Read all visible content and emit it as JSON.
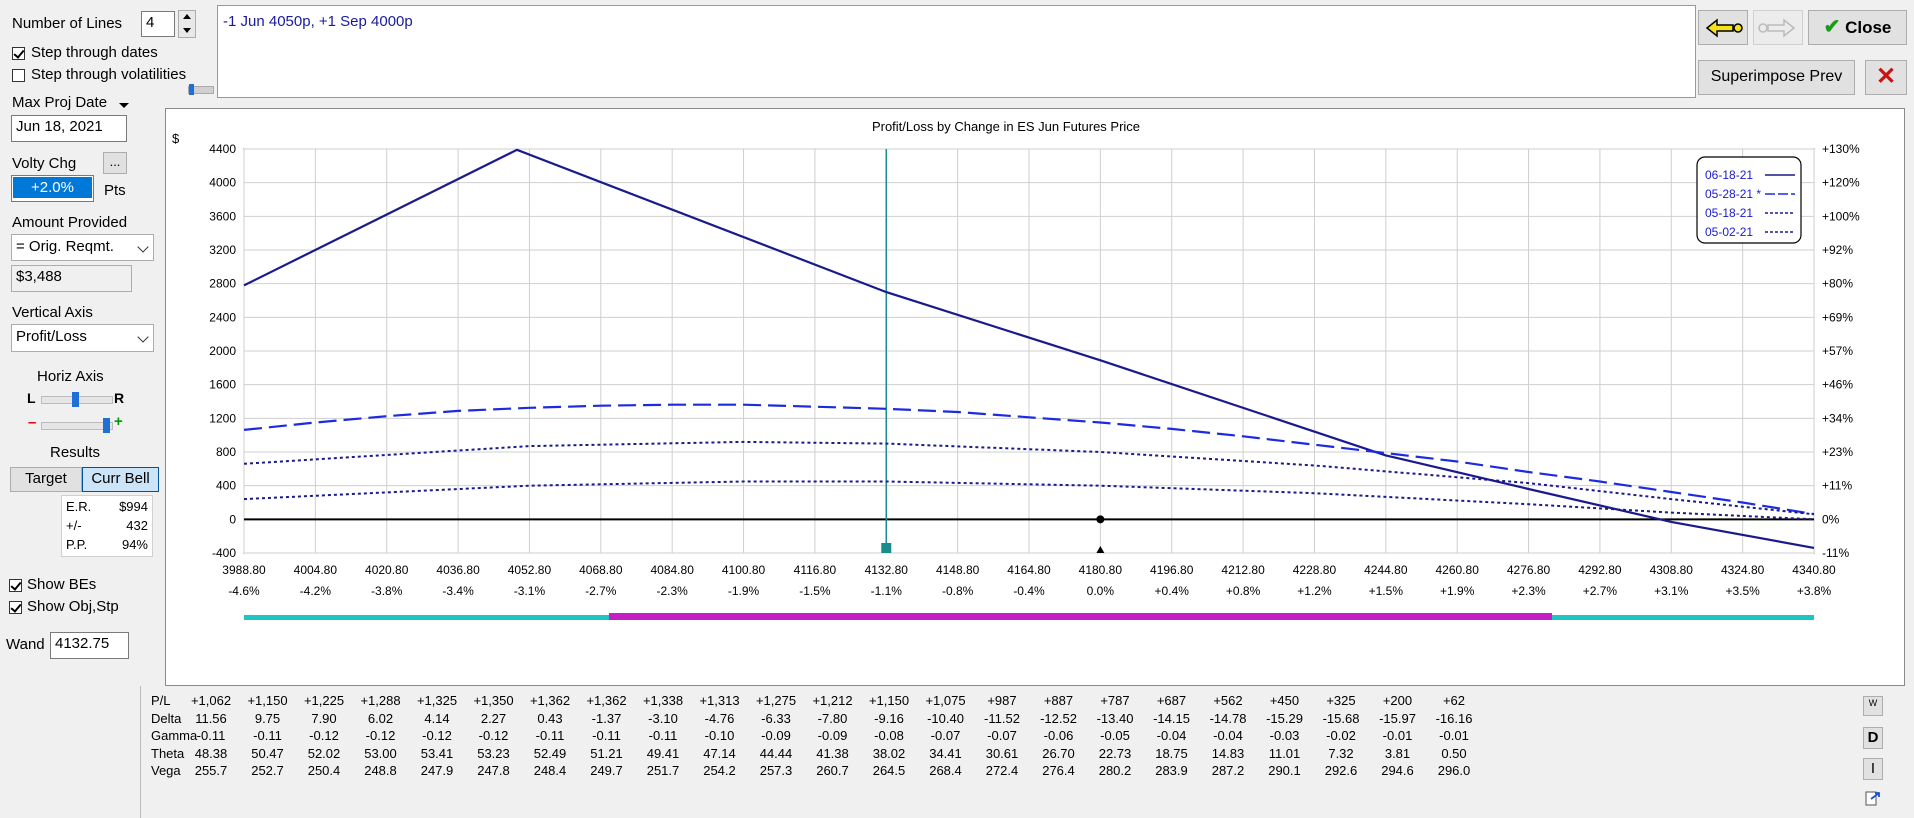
{
  "controls": {
    "number_of_lines_label": "Number of Lines",
    "number_of_lines_value": "4",
    "step_through_dates": "Step through dates",
    "step_through_volatilities": "Step through volatilities",
    "max_proj_date_label": "Max Proj Date",
    "max_proj_date_value": "Jun 18, 2021",
    "volty_chg_label": "Volty Chg",
    "volty_chg_value": "+2.0%",
    "volty_more": "...",
    "pts_label": "Pts",
    "amount_provided_label": "Amount Provided",
    "amount_provided_value": "= Orig. Reqmt.",
    "amount_value": "$3,488",
    "vertical_axis_label": "Vertical Axis",
    "vertical_axis_value": "Profit/Loss",
    "horiz_axis_label": "Horiz Axis",
    "slider_l": "L",
    "slider_r": "R",
    "slider_minus": "–",
    "slider_plus": "+",
    "results_label": "Results",
    "target_button": "Target",
    "curr_bell_button": "Curr Bell",
    "er_label": "E.R.",
    "er_value": "$994",
    "pm_label": "+/-",
    "pm_value": "432",
    "pp_label": "P.P.",
    "pp_value": "94%",
    "show_bes": "Show BEs",
    "show_obj_stp": "Show Obj,Stp",
    "wand_label": "Wand",
    "wand_value": "4132.75"
  },
  "position_text": "-1 Jun 4050p, +1 Sep 4000p",
  "toolbar": {
    "close_label": "Close",
    "superimpose_label": "Superimpose Prev"
  },
  "colors": {
    "line": "#1a1a8c",
    "dashed": "#1d2be0",
    "cursor": "#1a8c8c",
    "band_teal": "#1fc4c4",
    "band_magenta": "#c41fc4"
  },
  "chart_data": {
    "type": "line",
    "title": "Profit/Loss by Change in ES Jun Futures Price",
    "ylabel": "$",
    "ylim": [
      -400,
      4400
    ],
    "yticks": [
      4400,
      4000,
      3600,
      3200,
      2800,
      2400,
      2000,
      1600,
      1200,
      800,
      400,
      0,
      -400
    ],
    "right_ticks": [
      "+130%",
      "+120%",
      "+100%",
      "+92%",
      "+80%",
      "+69%",
      "+57%",
      "+46%",
      "+34%",
      "+23%",
      "+11%",
      "0%",
      "-11%"
    ],
    "x_ticks": [
      "3988.80",
      "4004.80",
      "4020.80",
      "4036.80",
      "4052.80",
      "4068.80",
      "4084.80",
      "4100.80",
      "4116.80",
      "4132.80",
      "4148.80",
      "4164.80",
      "4180.80",
      "4196.80",
      "4212.80",
      "4228.80",
      "4244.80",
      "4260.80",
      "4276.80",
      "4292.80",
      "4308.80",
      "4324.80",
      "4340.80"
    ],
    "x_pct": [
      "-4.6%",
      "-4.2%",
      "-3.8%",
      "-3.4%",
      "-3.1%",
      "-2.7%",
      "-2.3%",
      "-1.9%",
      "-1.5%",
      "-1.1%",
      "-0.8%",
      "-0.4%",
      "0.0%",
      "+0.4%",
      "+0.8%",
      "+1.2%",
      "+1.5%",
      "+1.9%",
      "+2.3%",
      "+2.7%",
      "+3.1%",
      "+3.5%",
      "+3.8%"
    ],
    "xlim": [
      3988.8,
      4340.8
    ],
    "cursor_x": 4132.8,
    "current_x": 4180.8,
    "series": [
      {
        "name": "06-18-21",
        "style": "solid",
        "x": [
          3988.8,
          4050,
          4132.8,
          4180.8,
          4244.8,
          4276.8,
          4308.8,
          4340.8
        ],
        "values": [
          2780,
          4390,
          2700,
          1890,
          760,
          360,
          -30,
          -340
        ]
      },
      {
        "name": "05-28-21",
        "legend_label": "05-28-21 *",
        "style": "longdash",
        "x": [
          3988.8,
          4004.8,
          4020.8,
          4036.8,
          4052.8,
          4068.8,
          4084.8,
          4100.8,
          4116.8,
          4132.8,
          4148.8,
          4164.8,
          4180.8,
          4196.8,
          4212.8,
          4228.8,
          4244.8,
          4260.8,
          4276.8,
          4292.8,
          4308.8,
          4324.8,
          4340.8
        ],
        "values": [
          1062,
          1150,
          1225,
          1288,
          1325,
          1350,
          1362,
          1362,
          1338,
          1313,
          1275,
          1212,
          1150,
          1075,
          987,
          887,
          787,
          687,
          562,
          450,
          325,
          200,
          62
        ]
      },
      {
        "name": "05-18-21",
        "style": "dotted",
        "x": [
          3988.8,
          4052.8,
          4100.8,
          4132.8,
          4180.8,
          4228.8,
          4276.8,
          4308.8,
          4340.8
        ],
        "values": [
          660,
          870,
          920,
          900,
          800,
          640,
          430,
          240,
          60
        ]
      },
      {
        "name": "05-02-21",
        "style": "dotted",
        "x": [
          3988.8,
          4052.8,
          4100.8,
          4132.8,
          4180.8,
          4228.8,
          4276.8,
          4308.8,
          4340.8
        ],
        "values": [
          240,
          400,
          450,
          450,
          400,
          310,
          180,
          80,
          0
        ]
      }
    ]
  },
  "table": {
    "row_labels": [
      "P/L",
      "Delta",
      "Gamma",
      "Theta",
      "Vega"
    ],
    "rows": [
      [
        "+1,062",
        "+1,150",
        "+1,225",
        "+1,288",
        "+1,325",
        "+1,350",
        "+1,362",
        "+1,362",
        "+1,338",
        "+1,313",
        "+1,275",
        "+1,212",
        "+1,150",
        "+1,075",
        "+987",
        "+887",
        "+787",
        "+687",
        "+562",
        "+450",
        "+325",
        "+200",
        "+62"
      ],
      [
        "11.56",
        "9.75",
        "7.90",
        "6.02",
        "4.14",
        "2.27",
        "0.43",
        "-1.37",
        "-3.10",
        "-4.76",
        "-6.33",
        "-7.80",
        "-9.16",
        "-10.40",
        "-11.52",
        "-12.52",
        "-13.40",
        "-14.15",
        "-14.78",
        "-15.29",
        "-15.68",
        "-15.97",
        "-16.16"
      ],
      [
        "-0.11",
        "-0.11",
        "-0.12",
        "-0.12",
        "-0.12",
        "-0.12",
        "-0.11",
        "-0.11",
        "-0.11",
        "-0.10",
        "-0.09",
        "-0.09",
        "-0.08",
        "-0.07",
        "-0.07",
        "-0.06",
        "-0.05",
        "-0.04",
        "-0.04",
        "-0.03",
        "-0.02",
        "-0.01",
        "-0.01"
      ],
      [
        "48.38",
        "50.47",
        "52.02",
        "53.00",
        "53.41",
        "53.23",
        "52.49",
        "51.21",
        "49.41",
        "47.14",
        "44.44",
        "41.38",
        "38.02",
        "34.41",
        "30.61",
        "26.70",
        "22.73",
        "18.75",
        "14.83",
        "11.01",
        "7.32",
        "3.81",
        "0.50"
      ],
      [
        "255.7",
        "252.7",
        "250.4",
        "248.8",
        "247.9",
        "247.8",
        "248.4",
        "249.7",
        "251.7",
        "254.2",
        "257.3",
        "260.7",
        "264.5",
        "268.4",
        "272.4",
        "276.4",
        "280.2",
        "283.9",
        "287.2",
        "290.1",
        "292.6",
        "294.6",
        "296.0"
      ]
    ],
    "side_w": "W",
    "side_d": "D",
    "side_i": "I"
  }
}
